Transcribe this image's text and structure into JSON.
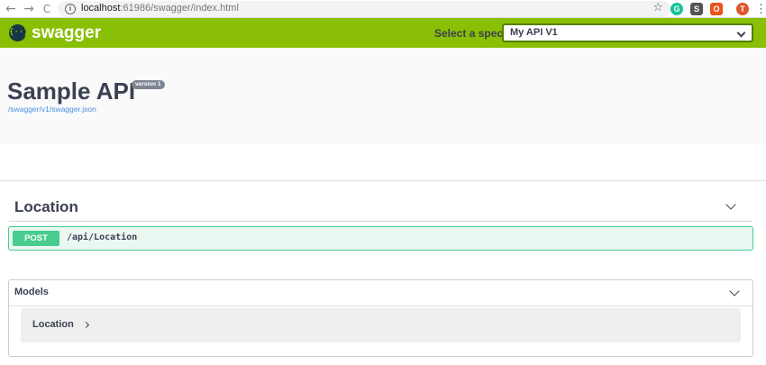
{
  "browser": {
    "url_host": "localhost",
    "url_rest": ":61986/swagger/index.html",
    "back_glyph": "←",
    "forward_glyph": "→",
    "reload_glyph": "C",
    "info_glyph": "i",
    "star_glyph": "☆",
    "extensions": [
      {
        "name": "grammarly",
        "glyph": "G",
        "color": "#15c39a"
      },
      {
        "name": "scribe",
        "glyph": "S",
        "color": "#555555"
      },
      {
        "name": "office",
        "glyph": "O",
        "color": "#e8541a"
      },
      {
        "name": "profile",
        "glyph": "T",
        "color": "#e0552d"
      }
    ],
    "menu_glyph": "⋮"
  },
  "topbar": {
    "logo_glyph": "{··}",
    "logo_text": "swagger",
    "spec_label": "Select a spec",
    "spec_value": "My API V1",
    "bg_color": "#89bf04"
  },
  "info": {
    "title": "Sample API",
    "version": "version 1",
    "spec_url": "/swagger/v1/swagger.json"
  },
  "tags": [
    {
      "name": "Location",
      "operations": [
        {
          "method": "POST",
          "path": "/api/Location",
          "color": "#49cc90"
        }
      ]
    }
  ],
  "models": {
    "title": "Models",
    "items": [
      "Location"
    ]
  }
}
